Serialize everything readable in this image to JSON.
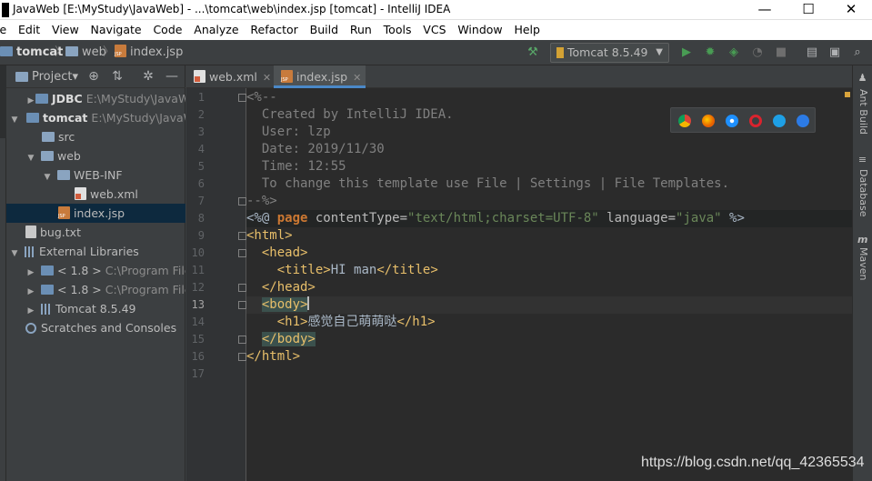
{
  "window": {
    "title": "JavaWeb [E:\\MyStudy\\JavaWeb] - ...\\tomcat\\web\\index.jsp [tomcat] - IntelliJ IDEA",
    "controls": [
      "—",
      "☐",
      "✕"
    ]
  },
  "menu": [
    "le",
    "Edit",
    "View",
    "Navigate",
    "Code",
    "Analyze",
    "Refactor",
    "Build",
    "Run",
    "Tools",
    "VCS",
    "Window",
    "Help"
  ],
  "breadcrumb": {
    "items": [
      "tomcat",
      "web",
      "index.jsp"
    ],
    "separator": "〉"
  },
  "toolbar": {
    "run_config": "Tomcat 8.5.49"
  },
  "project_panel": {
    "title": "Project",
    "tree": [
      {
        "label": "JDBC",
        "path": "E:\\MyStudy\\JavaWeb"
      },
      {
        "label": "tomcat",
        "path": "E:\\MyStudy\\JavaW"
      },
      {
        "label": "src"
      },
      {
        "label": "web"
      },
      {
        "label": "WEB-INF"
      },
      {
        "label": "web.xml"
      },
      {
        "label": "index.jsp"
      },
      {
        "label": "bug.txt"
      },
      {
        "label": "External Libraries"
      },
      {
        "label": "< 1.8 >",
        "path": "C:\\Program File"
      },
      {
        "label": "< 1.8 >",
        "path": "C:\\Program File"
      },
      {
        "label": "Tomcat 8.5.49"
      },
      {
        "label": "Scratches and Consoles"
      }
    ]
  },
  "editor_tabs": [
    {
      "label": "web.xml"
    },
    {
      "label": "index.jsp"
    }
  ],
  "editor": {
    "line_numbers": [
      "1",
      "2",
      "3",
      "4",
      "5",
      "6",
      "7",
      "8",
      "9",
      "10",
      "11",
      "12",
      "13",
      "14",
      "15",
      "16",
      "17"
    ],
    "current_line": "13",
    "code": {
      "l1": "<%--",
      "l2": "  Created by IntelliJ IDEA.",
      "l3": "  User: lzp",
      "l4": "  Date: 2019/11/30",
      "l5": "  Time: 12:55",
      "l6": "  To change this template use File | Settings | File Templates.",
      "l7": "--%>",
      "l8_open": "<%@ ",
      "l8_kw": "page",
      "l8_attr1": " contentType=",
      "l8_val1": "\"text/html;charset=UTF-8\"",
      "l8_attr2": " language=",
      "l8_val2": "\"java\"",
      "l8_close": " %>",
      "l9": "<html>",
      "l10": "  <head>",
      "l11_pre": "    ",
      "l11_open": "<title>",
      "l11_text": "HI man",
      "l11_close": "</title>",
      "l12": "  </head>",
      "l13_pre": "  ",
      "l13_tag": "<body>",
      "l14_pre": "    ",
      "l14_open": "<h1>",
      "l14_text": "感觉自己萌萌哒",
      "l14_close": "</h1>",
      "l15_pre": "  ",
      "l15_tag": "</body>",
      "l16": "</html>",
      "l17": ""
    }
  },
  "right_stripe": [
    "Ant Build",
    "Database",
    "Maven"
  ],
  "watermark": "https://blog.csdn.net/qq_42365534",
  "colors": {
    "background": "#2b2b2b",
    "tag": "#e8bf6a",
    "string": "#6a8759",
    "keyword": "#cc7832",
    "comment": "#808080"
  }
}
